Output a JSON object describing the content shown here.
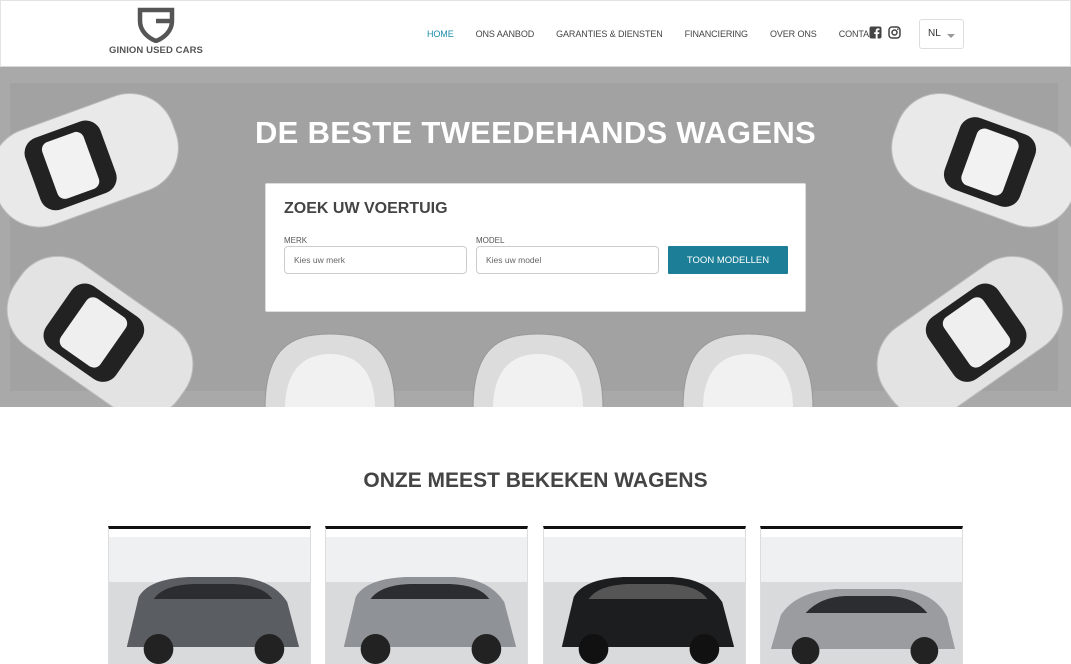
{
  "header": {
    "logo_text": "GINION USED CARS",
    "nav": [
      {
        "label": "HOME",
        "active": true
      },
      {
        "label": "ONS AANBOD",
        "active": false
      },
      {
        "label": "GARANTIES & DIENSTEN",
        "active": false
      },
      {
        "label": "FINANCIERING",
        "active": false
      },
      {
        "label": "OVER ONS",
        "active": false
      },
      {
        "label": "CONTACT",
        "active": false
      }
    ],
    "social": [
      "facebook-icon",
      "instagram-icon"
    ],
    "language": "NL"
  },
  "hero": {
    "title": "DE BESTE TWEEDEHANDS WAGENS",
    "search": {
      "title": "ZOEK UW VOERTUIG",
      "brand_label": "MERK",
      "brand_placeholder": "Kies uw merk",
      "model_label": "MODEL",
      "model_placeholder": "Kies uw model",
      "button": "TOON MODELLEN"
    }
  },
  "section": {
    "title": "ONZE MEEST BEKEKEN WAGENS"
  },
  "cards": [
    {
      "color": "#5a5d61"
    },
    {
      "color": "#8f9296"
    },
    {
      "color": "#1c1d1f"
    },
    {
      "color": "#9a9ca0"
    }
  ],
  "colors": {
    "accent": "#1c8ca8",
    "button": "#1d7f97"
  }
}
